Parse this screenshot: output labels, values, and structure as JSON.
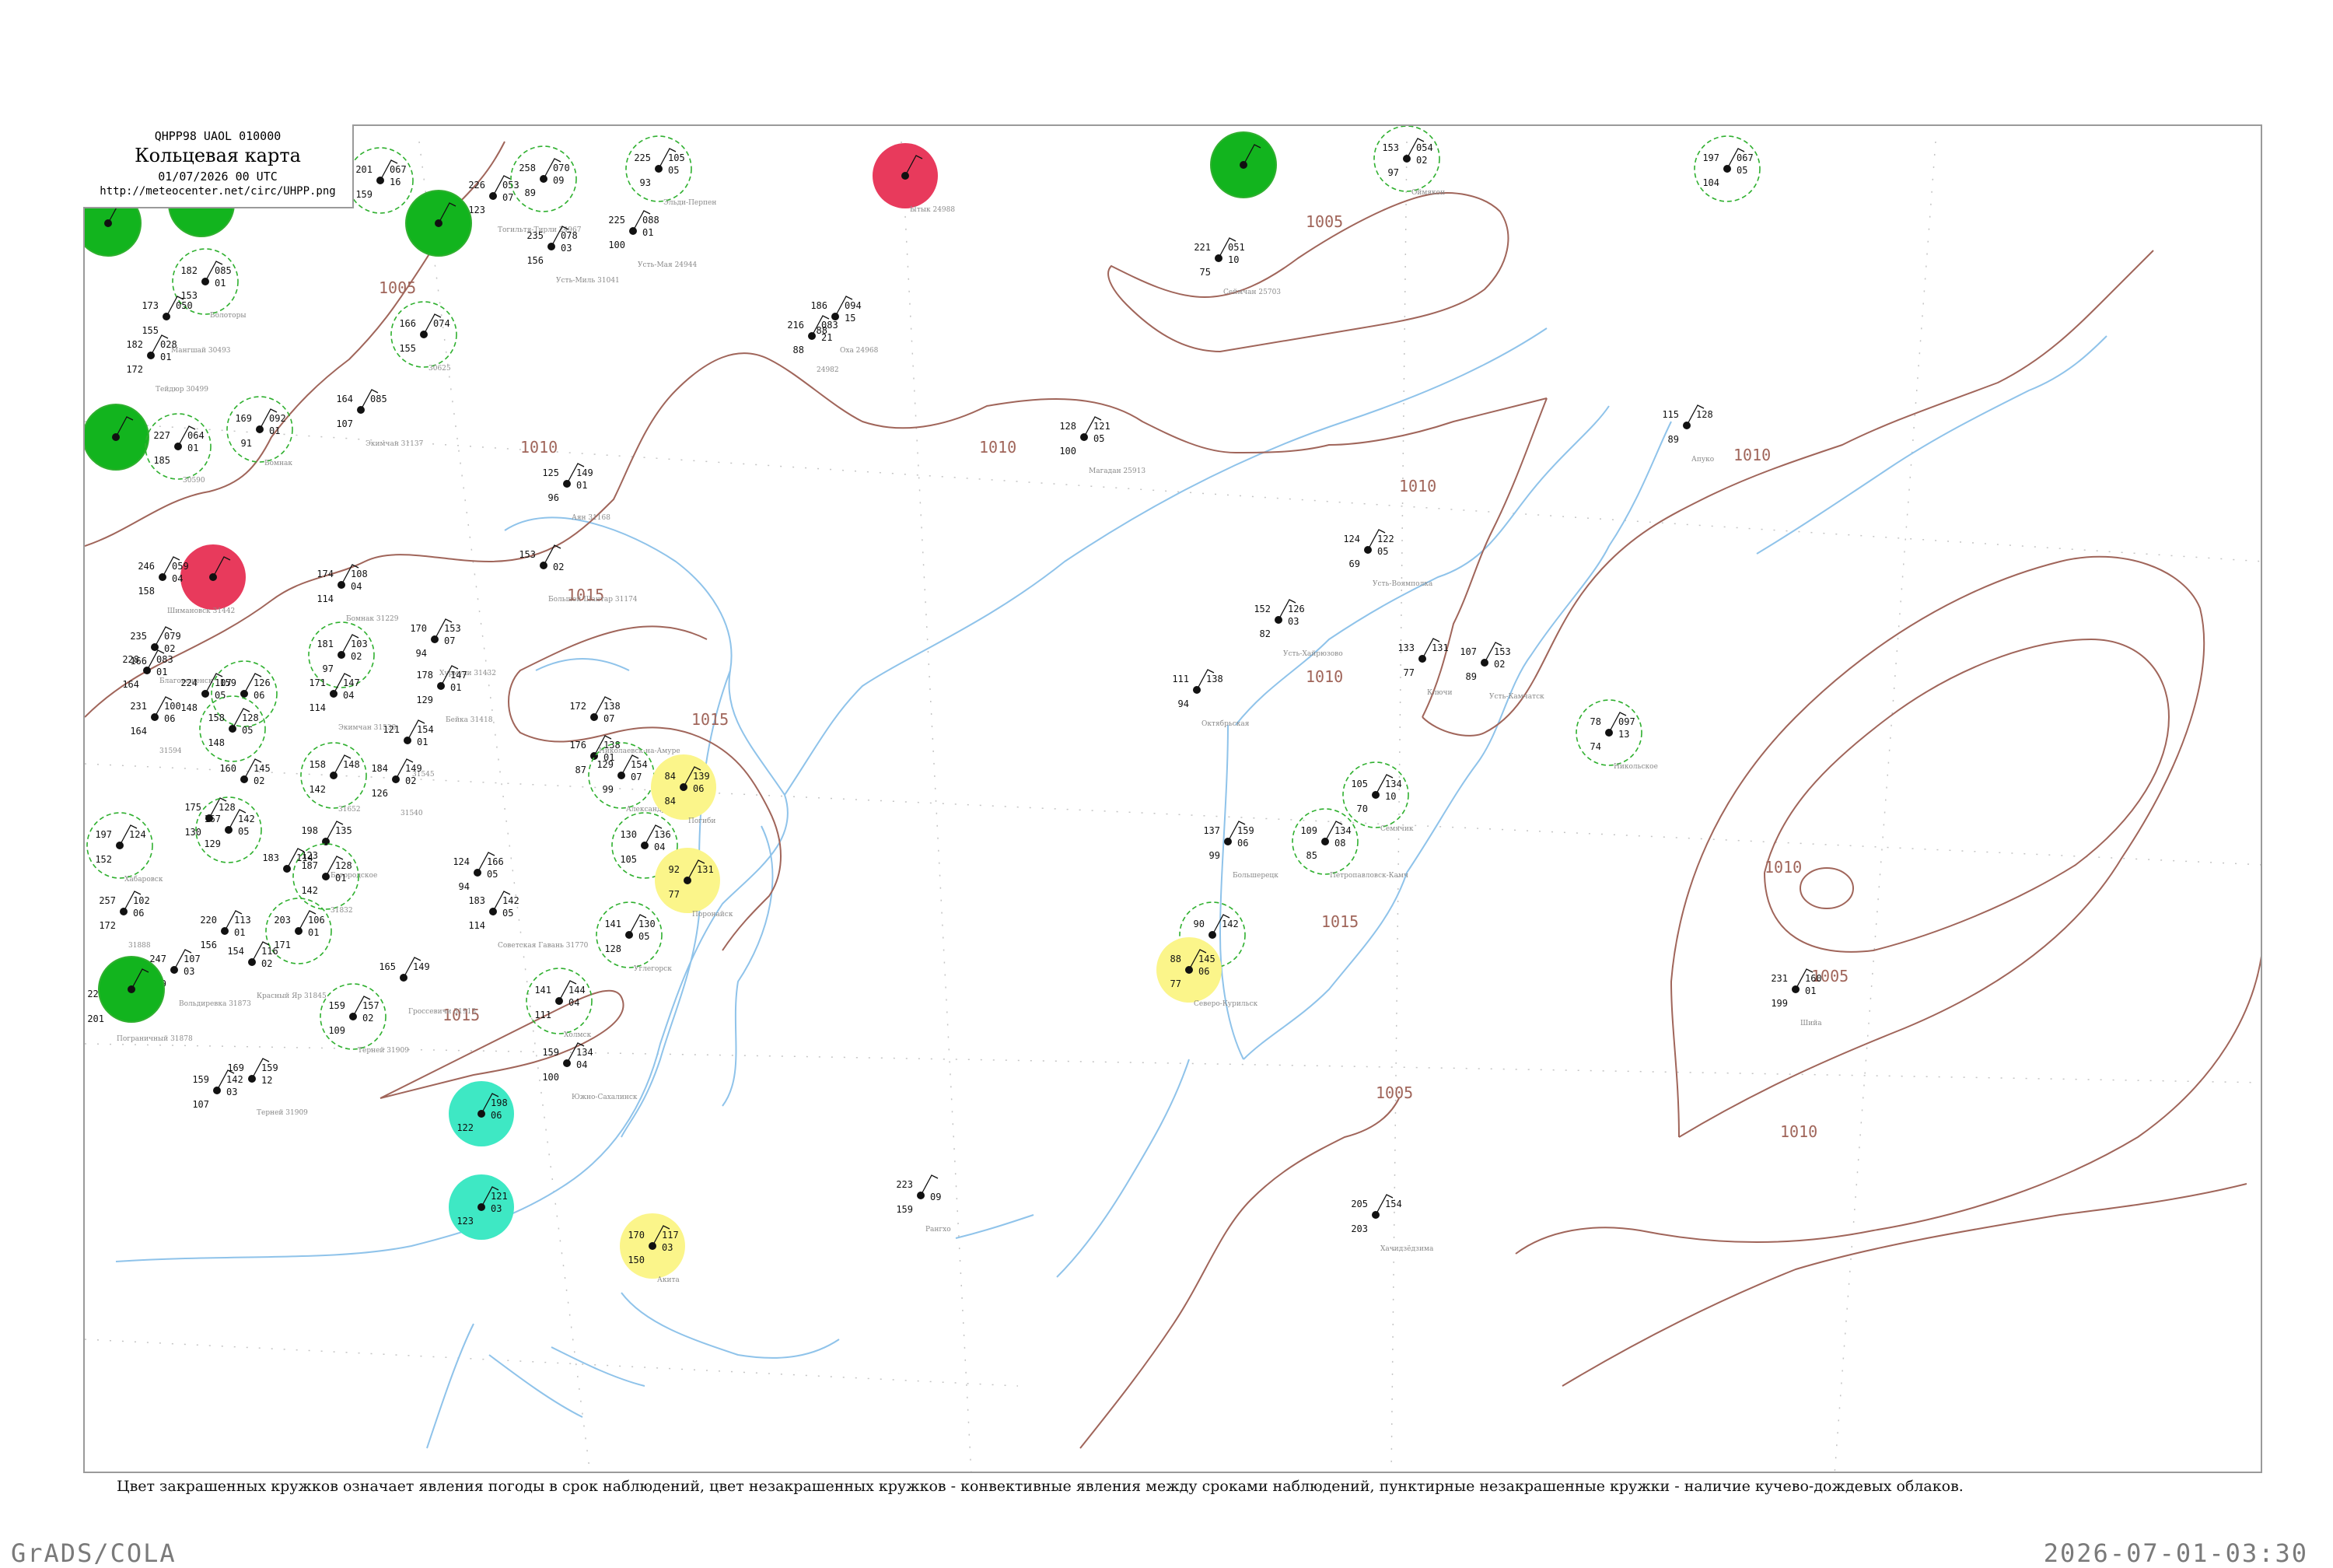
{
  "map": {
    "code_line": "QHPP98  UAOL  010000",
    "title": "Кольцевая карта",
    "date_line": "01/07/2026 00 UTC",
    "url": "http://meteocenter.net/circ/UHPP.png",
    "legend_note": "Цвет закрашенных кружков означает явления погоды в срок наблюдений, цвет незакрашенных кружков - конвективные явления между сроками наблюдений, пунктирные незакрашенные кружки - наличие кучево-дождевых облаков.",
    "footer_left": "GrADS/COLA",
    "footer_right": "2026-07-01-03:30"
  },
  "colors": {
    "isobar": "#a0655a",
    "coast": "#8fc3ea",
    "circle_green": "#2fb02f",
    "fill_green": "#12b41e",
    "fill_red": "#e83a5c",
    "fill_yellow": "#fbf58a",
    "fill_cyan": "#3ee8c4",
    "grid": "#bcbcbc"
  },
  "isobar_labels": [
    "1005",
    "1010",
    "1010",
    "1010",
    "1010",
    "1010",
    "1010",
    "1015",
    "1015",
    "1015",
    "1015",
    "1005",
    "1010",
    "1005",
    "1005"
  ],
  "stations": [
    {
      "id": "s1",
      "t": "201",
      "td": "159",
      "p": "067",
      "pt": "16",
      "name": "",
      "kind": "ring"
    },
    {
      "id": "s2",
      "t": "",
      "td": "",
      "p": "",
      "pt": "",
      "name": "",
      "kind": "green"
    },
    {
      "id": "s3",
      "t": "",
      "td": "",
      "p": "",
      "pt": "",
      "name": "",
      "kind": "green"
    },
    {
      "id": "s4",
      "t": "182",
      "td": "153",
      "p": "085",
      "pt": "01",
      "name": "Болоторы",
      "kind": "ring"
    },
    {
      "id": "s5",
      "t": "173",
      "td": "155",
      "p": "050",
      "pt": "",
      "name": "Мангшай 30493",
      "kind": "plain"
    },
    {
      "id": "s6",
      "t": "182",
      "td": "172",
      "p": "028",
      "pt": "01",
      "name": "Тейдюр 30499",
      "kind": "plain"
    },
    {
      "id": "s7",
      "t": "",
      "td": "",
      "p": "",
      "pt": "",
      "name": "",
      "kind": "green"
    },
    {
      "id": "s8",
      "t": "227",
      "td": "185",
      "p": "064",
      "pt": "01",
      "name": "30590",
      "kind": "ring"
    },
    {
      "id": "s9",
      "t": "169",
      "td": "91",
      "p": "092",
      "pt": "01",
      "name": "Бомнак",
      "kind": "ring"
    },
    {
      "id": "s10",
      "t": "",
      "td": "",
      "p": "",
      "pt": "",
      "name": "",
      "kind": "red"
    },
    {
      "id": "s11",
      "t": "246",
      "td": "158",
      "p": "059",
      "pt": "04",
      "name": "Шимановск 31442",
      "kind": "plain"
    },
    {
      "id": "s12",
      "t": "226",
      "td": "123",
      "p": "053",
      "pt": "07",
      "name": "Тогильтя-Тирли 24967",
      "kind": "plain"
    },
    {
      "id": "s13",
      "t": "258",
      "td": "89",
      "p": "070",
      "pt": "09",
      "name": "",
      "kind": "ring"
    },
    {
      "id": "s14",
      "t": "225",
      "td": "100",
      "p": "088",
      "pt": "01",
      "name": "Усть-Мая 24944",
      "kind": "plain"
    },
    {
      "id": "s15",
      "t": "235",
      "td": "156",
      "p": "078",
      "pt": "03",
      "name": "Усть-Миль 31041",
      "kind": "plain"
    },
    {
      "id": "s16",
      "t": "225",
      "td": "93",
      "p": "105",
      "pt": "05",
      "name": "Эльди-Перпен",
      "kind": "ring"
    },
    {
      "id": "s17",
      "t": "166",
      "td": "155",
      "p": "074",
      "pt": "",
      "name": "30625",
      "kind": "ring"
    },
    {
      "id": "s18",
      "t": "164",
      "td": "107",
      "p": "085",
      "pt": "",
      "name": "Экимчан 31137",
      "kind": "plain"
    },
    {
      "id": "s19",
      "t": "186",
      "td": "88",
      "p": "094",
      "pt": "15",
      "name": "Оха 24968",
      "kind": "plain"
    },
    {
      "id": "s20",
      "t": "216",
      "td": "88",
      "p": "083",
      "pt": "21",
      "name": "24982",
      "kind": "plain"
    },
    {
      "id": "s21",
      "t": "",
      "td": "",
      "p": "",
      "pt": "",
      "name": "Ытык 24988",
      "kind": "red"
    },
    {
      "id": "s22",
      "t": "",
      "td": "",
      "p": "",
      "pt": "",
      "name": "",
      "kind": "green"
    },
    {
      "id": "s23",
      "t": "153",
      "td": "97",
      "p": "054",
      "pt": "02",
      "name": "Оймякон",
      "kind": "ring"
    },
    {
      "id": "s24",
      "t": "197",
      "td": "104",
      "p": "067",
      "pt": "05",
      "name": "",
      "kind": "ring"
    },
    {
      "id": "s25",
      "t": "221",
      "td": "75",
      "p": "051",
      "pt": "10",
      "name": "Сеймчан 25703",
      "kind": "plain"
    },
    {
      "id": "s26",
      "t": "128",
      "td": "100",
      "p": "121",
      "pt": "05",
      "name": "Магадан 25913",
      "kind": "plain"
    },
    {
      "id": "s27",
      "t": "125",
      "td": "96",
      "p": "149",
      "pt": "01",
      "name": "Аян 31168",
      "kind": "plain"
    },
    {
      "id": "s28",
      "t": "153",
      "td": "",
      "p": "",
      "pt": "02",
      "name": "Большой Шантар 31174",
      "kind": "plain"
    },
    {
      "id": "s29",
      "t": "174",
      "td": "114",
      "p": "108",
      "pt": "04",
      "name": "Бомнак 31229",
      "kind": "plain"
    },
    {
      "id": "s30",
      "t": "181",
      "td": "97",
      "p": "103",
      "pt": "02",
      "name": "",
      "kind": "ring"
    },
    {
      "id": "s31",
      "t": "170",
      "td": "94",
      "p": "153",
      "pt": "07",
      "name": "Хурмули 31432",
      "kind": "plain"
    },
    {
      "id": "s32",
      "t": "178",
      "td": "129",
      "p": "147",
      "pt": "01",
      "name": "Бейка 31418",
      "kind": "plain"
    },
    {
      "id": "s33",
      "t": "235",
      "td": "166",
      "p": "079",
      "pt": "02",
      "name": "Благовещенск",
      "kind": "plain"
    },
    {
      "id": "s34",
      "t": "228",
      "td": "164",
      "p": "083",
      "pt": "01",
      "name": "",
      "kind": "plain"
    },
    {
      "id": "s35",
      "t": "224",
      "td": "148",
      "p": "107",
      "pt": "05",
      "name": "",
      "kind": "plain"
    },
    {
      "id": "s36",
      "t": "159",
      "td": "",
      "p": "126",
      "pt": "06",
      "name": "",
      "kind": "ring"
    },
    {
      "id": "s37",
      "t": "231",
      "td": "164",
      "p": "100",
      "pt": "06",
      "name": "31594",
      "kind": "plain"
    },
    {
      "id": "s38",
      "t": "158",
      "td": "148",
      "p": "128",
      "pt": "05",
      "name": "",
      "kind": "ring"
    },
    {
      "id": "s39",
      "t": "171",
      "td": "114",
      "p": "147",
      "pt": "04",
      "name": "Экимчан 31538",
      "kind": "plain"
    },
    {
      "id": "s40",
      "t": "121",
      "td": "",
      "p": "154",
      "pt": "01",
      "name": "31545",
      "kind": "plain"
    },
    {
      "id": "s41",
      "t": "184",
      "td": "126",
      "p": "149",
      "pt": "02",
      "name": "31540",
      "kind": "plain"
    },
    {
      "id": "s42",
      "t": "158",
      "td": "142",
      "p": "148",
      "pt": "",
      "name": "31652",
      "kind": "ring"
    },
    {
      "id": "s43",
      "t": "160",
      "td": "",
      "p": "145",
      "pt": "02",
      "name": "",
      "kind": "plain"
    },
    {
      "id": "s44",
      "t": "175",
      "td": "130",
      "p": "128",
      "pt": "",
      "name": "",
      "kind": "plain"
    },
    {
      "id": "s45",
      "t": "167",
      "td": "129",
      "p": "142",
      "pt": "05",
      "name": "",
      "kind": "ring"
    },
    {
      "id": "s46",
      "t": "197",
      "td": "152",
      "p": "124",
      "pt": "",
      "name": "Хабаровск",
      "kind": "ring"
    },
    {
      "id": "s47",
      "t": "198",
      "td": "123",
      "p": "135",
      "pt": "",
      "name": "Богородское",
      "kind": "plain"
    },
    {
      "id": "s48",
      "t": "187",
      "td": "142",
      "p": "128",
      "pt": "01",
      "name": "31832",
      "kind": "ring"
    },
    {
      "id": "s49",
      "t": "183",
      "td": "",
      "p": "114",
      "pt": "",
      "name": "",
      "kind": "plain"
    },
    {
      "id": "s50",
      "t": "257",
      "td": "172",
      "p": "102",
      "pt": "06",
      "name": "31888",
      "kind": "plain"
    },
    {
      "id": "s51",
      "t": "220",
      "td": "156",
      "p": "113",
      "pt": "01",
      "name": "",
      "kind": "plain"
    },
    {
      "id": "s52",
      "t": "203",
      "td": "171",
      "p": "106",
      "pt": "01",
      "name": "",
      "kind": "ring"
    },
    {
      "id": "s53",
      "t": "247",
      "td": "209",
      "p": "107",
      "pt": "03",
      "name": "Вольдиревка 31873",
      "kind": "plain"
    },
    {
      "id": "s54",
      "t": "154",
      "td": "",
      "p": "116",
      "pt": "02",
      "name": "Красный Яр 31845",
      "kind": "plain"
    },
    {
      "id": "s55",
      "t": "228",
      "td": "201",
      "p": "109",
      "pt": "01",
      "name": "Пограничный 31878",
      "kind": "plain"
    },
    {
      "id": "s56",
      "t": "165",
      "td": "",
      "p": "149",
      "pt": "",
      "name": "Гроссевичи 31913",
      "kind": "plain"
    },
    {
      "id": "s57",
      "t": "159",
      "td": "109",
      "p": "157",
      "pt": "02",
      "name": "Терней 31909",
      "kind": "ring"
    },
    {
      "id": "s58",
      "t": "159",
      "td": "107",
      "p": "142",
      "pt": "03",
      "name": "",
      "kind": "plain"
    },
    {
      "id": "s59",
      "t": "169",
      "td": "",
      "p": "159",
      "pt": "12",
      "name": "Терней 31909",
      "kind": "plain"
    },
    {
      "id": "s60",
      "t": "124",
      "td": "94",
      "p": "166",
      "pt": "05",
      "name": "",
      "kind": "plain"
    },
    {
      "id": "s61",
      "t": "183",
      "td": "114",
      "p": "142",
      "pt": "05",
      "name": "Советская Гавань 31770",
      "kind": "plain"
    },
    {
      "id": "s62",
      "t": "172",
      "td": "",
      "p": "138",
      "pt": "07",
      "name": "Николаевск-на-Амуре",
      "kind": "plain"
    },
    {
      "id": "s63",
      "t": "176",
      "td": "87",
      "p": "138",
      "pt": "01",
      "name": "",
      "kind": "plain"
    },
    {
      "id": "s64",
      "t": "129",
      "td": "99",
      "p": "154",
      "pt": "07",
      "name": "Александровск",
      "kind": "ring"
    },
    {
      "id": "s65",
      "t": "84",
      "td": "84",
      "p": "139",
      "pt": "06",
      "name": "Погиби",
      "kind": "yellow"
    },
    {
      "id": "s66",
      "t": "130",
      "td": "105",
      "p": "136",
      "pt": "04",
      "name": "",
      "kind": "ring"
    },
    {
      "id": "s67",
      "t": "92",
      "td": "77",
      "p": "131",
      "pt": "",
      "name": "Поронайск",
      "kind": "yellow"
    },
    {
      "id": "s68",
      "t": "141",
      "td": "128",
      "p": "130",
      "pt": "05",
      "name": "Углегорск",
      "kind": "ring"
    },
    {
      "id": "s69",
      "t": "141",
      "td": "111",
      "p": "144",
      "pt": "04",
      "name": "Холмск",
      "kind": "ring"
    },
    {
      "id": "s70",
      "t": "159",
      "td": "100",
      "p": "134",
      "pt": "04",
      "name": "Южно-Сахалинск",
      "kind": "plain"
    },
    {
      "id": "s71",
      "t": "111",
      "td": "94",
      "p": "138",
      "pt": "",
      "name": "Октябрьская",
      "kind": "plain"
    },
    {
      "id": "s72",
      "t": "152",
      "td": "82",
      "p": "126",
      "pt": "03",
      "name": "Усть-Хайрюзово",
      "kind": "plain"
    },
    {
      "id": "s73",
      "t": "124",
      "td": "69",
      "p": "122",
      "pt": "05",
      "name": "Усть-Воямполка",
      "kind": "plain"
    },
    {
      "id": "s74",
      "t": "133",
      "td": "77",
      "p": "131",
      "pt": "",
      "name": "Ключи",
      "kind": "plain"
    },
    {
      "id": "s75",
      "t": "107",
      "td": "89",
      "p": "153",
      "pt": "02",
      "name": "Усть-Камчатск",
      "kind": "plain"
    },
    {
      "id": "s76",
      "t": "78",
      "td": "74",
      "p": "097",
      "pt": "13",
      "name": "Никольское",
      "kind": "ring"
    },
    {
      "id": "s77",
      "t": "105",
      "td": "70",
      "p": "134",
      "pt": "10",
      "name": "Семячик",
      "kind": "ring"
    },
    {
      "id": "s78",
      "t": "109",
      "td": "85",
      "p": "134",
      "pt": "08",
      "name": "Петропавловск-Камч",
      "kind": "ring"
    },
    {
      "id": "s79",
      "t": "137",
      "td": "99",
      "p": "159",
      "pt": "06",
      "name": "Большерецк",
      "kind": "plain"
    },
    {
      "id": "s80",
      "t": "90",
      "td": "",
      "p": "142",
      "pt": "",
      "name": "",
      "kind": "ring"
    },
    {
      "id": "s81",
      "t": "88",
      "td": "77",
      "p": "145",
      "pt": "06",
      "name": "Северо-Курильск",
      "kind": "yellow"
    },
    {
      "id": "s82",
      "t": "115",
      "td": "89",
      "p": "128",
      "pt": "",
      "name": "Апуко",
      "kind": "plain"
    },
    {
      "id": "s83",
      "t": "231",
      "td": "199",
      "p": "160",
      "pt": "01",
      "name": "Шийа",
      "kind": "plain"
    },
    {
      "id": "s84",
      "t": "223",
      "td": "159",
      "p": "",
      "pt": "09",
      "name": "Рангхо",
      "kind": "plain"
    },
    {
      "id": "s85",
      "t": "205",
      "td": "203",
      "p": "154",
      "pt": "",
      "name": "Хачидзёдзима",
      "kind": "plain"
    },
    {
      "id": "s86",
      "t": "",
      "td": "122",
      "p": "198",
      "pt": "06",
      "name": "",
      "kind": "cyan"
    },
    {
      "id": "s87",
      "t": "",
      "td": "123",
      "p": "121",
      "pt": "03",
      "name": "",
      "kind": "cyan"
    },
    {
      "id": "s88",
      "t": "170",
      "td": "150",
      "p": "117",
      "pt": "03",
      "name": "Акита",
      "kind": "yellow"
    },
    {
      "id": "s89",
      "t": "",
      "td": "",
      "p": "",
      "pt": "",
      "name": "",
      "kind": "green"
    },
    {
      "id": "s90",
      "t": "",
      "td": "",
      "p": "",
      "pt": "",
      "name": "",
      "kind": "green"
    }
  ]
}
